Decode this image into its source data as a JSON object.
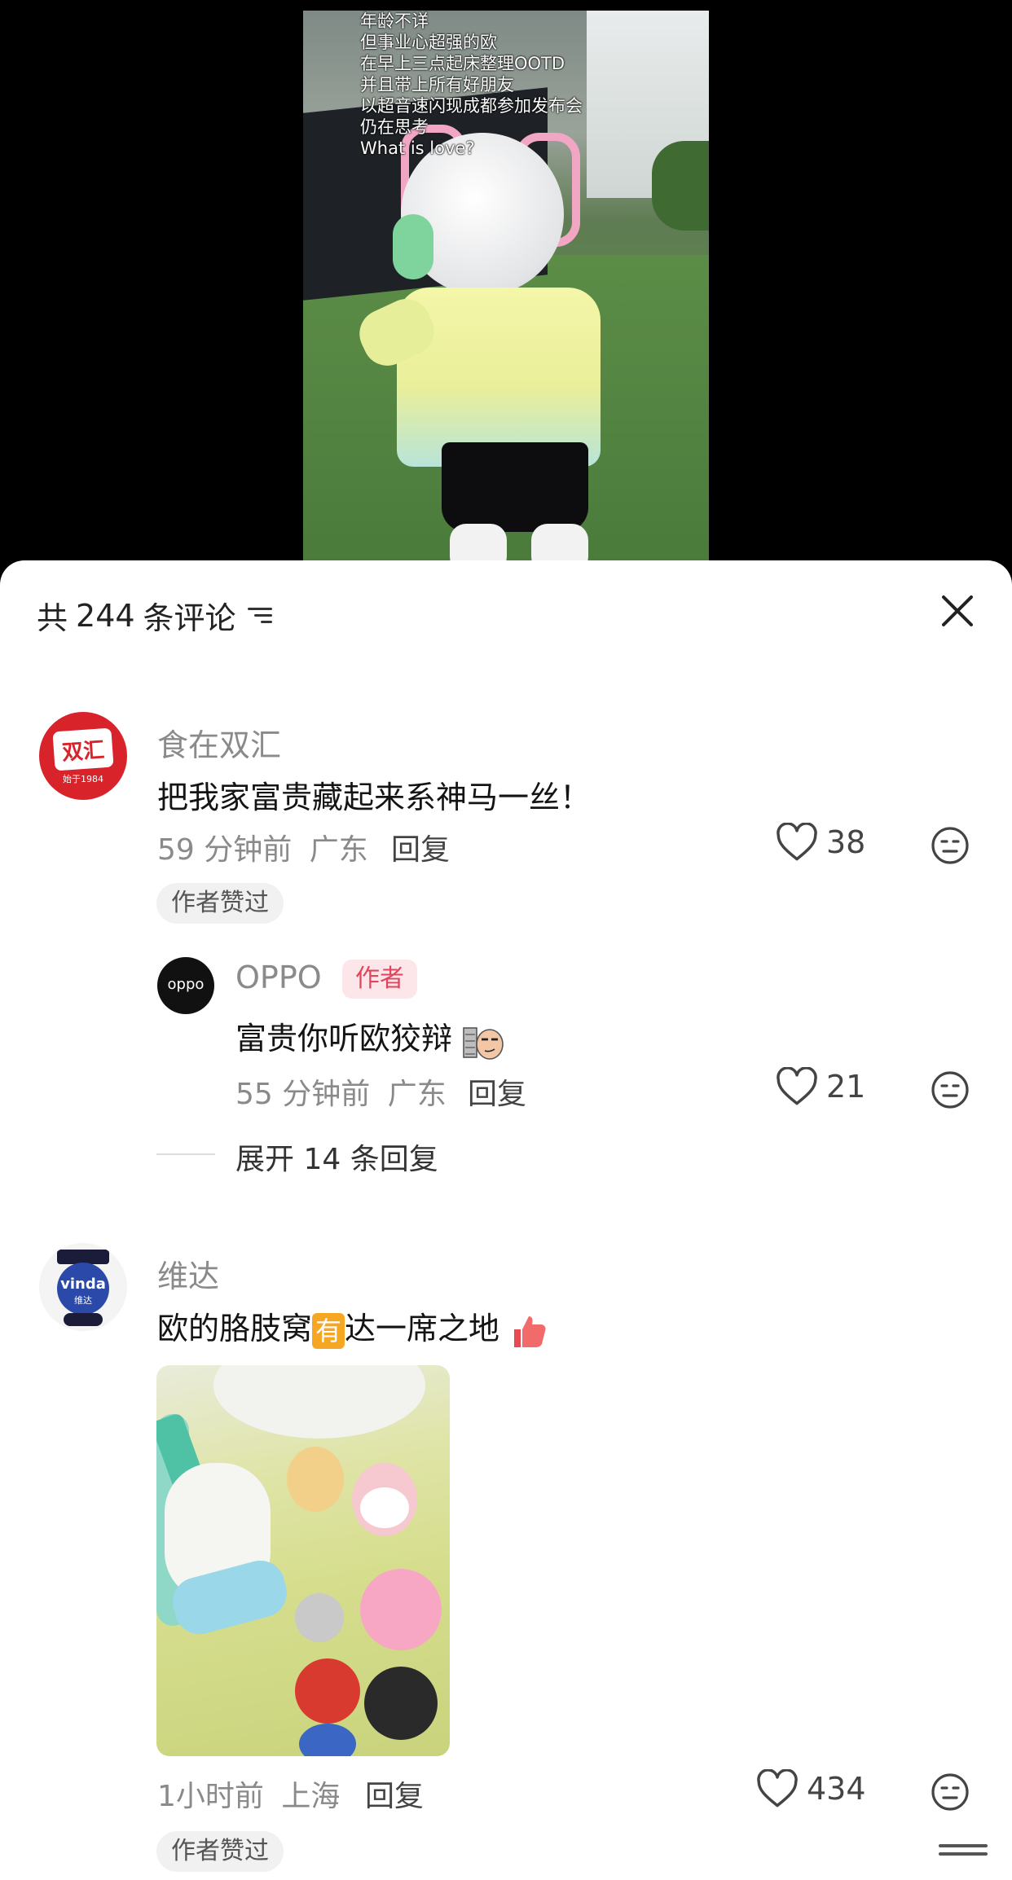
{
  "video": {
    "subtitle_lines": [
      "年龄不详",
      "但事业心超强的欧",
      "在早上三点起床整理OOTD",
      "并且带上所有好朋友",
      "以超音速闪现成都参加发布会",
      "仍在思考",
      "What is love?"
    ]
  },
  "comments_header": {
    "prefix": "共",
    "count": "244",
    "suffix": "条评论",
    "filter_icon": "filter-icon",
    "close_icon": "close-icon"
  },
  "comments": [
    {
      "avatar_logo": "双汇",
      "avatar_sub": "始于1984",
      "username": "食在双汇",
      "text": "把我家富贵藏起来系神马一丝！",
      "time": "59 分钟前",
      "location": "广东",
      "reply_label": "回复",
      "likes": "38",
      "tag": "作者赞过"
    },
    {
      "avatar_logo": "vinda",
      "avatar_sub": "维达",
      "username": "维达",
      "text_before": "欧的胳肢窝",
      "text_badge": "有",
      "text_after": "达一席之地",
      "time": "1小时前",
      "location": "上海",
      "reply_label": "回复",
      "likes": "434",
      "tag": "作者赞过"
    }
  ],
  "reply": {
    "avatar_logo": "oppo",
    "username": "OPPO",
    "author_badge": "作者",
    "text": "富贵你听欧狡辩",
    "time": "55 分钟前",
    "location": "广东",
    "reply_label": "回复",
    "likes": "21"
  },
  "expand_replies": "展开 14 条回复",
  "colors": {
    "accent_red": "#e0455b",
    "shuanghui_red": "#d8232a"
  }
}
